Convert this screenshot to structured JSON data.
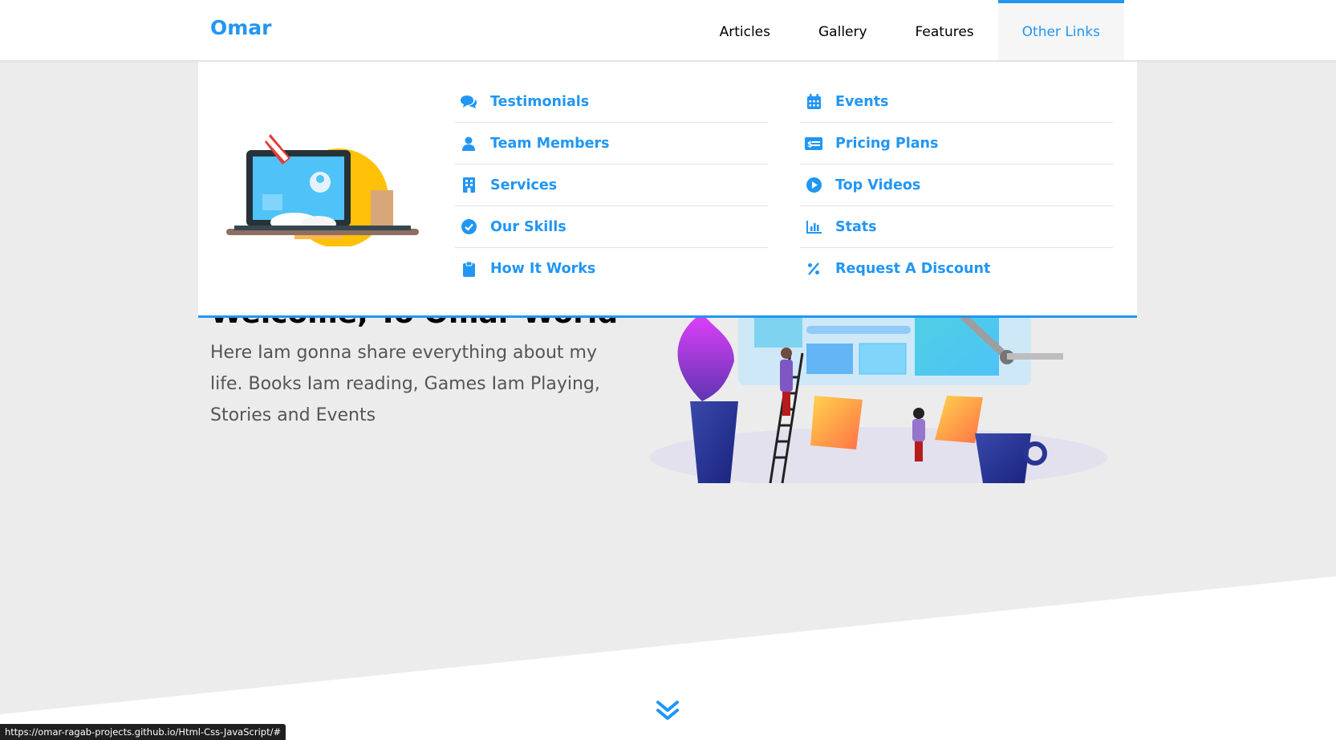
{
  "header": {
    "logo": "Omar",
    "nav": [
      "Articles",
      "Gallery",
      "Features",
      "Other Links"
    ],
    "active_nav": "Other Links"
  },
  "mega_menu": {
    "left_column": [
      {
        "label": "Testimonials",
        "icon": "comments-icon"
      },
      {
        "label": "Team Members",
        "icon": "user-icon"
      },
      {
        "label": "Services",
        "icon": "building-icon"
      },
      {
        "label": "Our Skills",
        "icon": "check-circle-icon"
      },
      {
        "label": "How It Works",
        "icon": "clipboard-icon"
      }
    ],
    "right_column": [
      {
        "label": "Events",
        "icon": "calendar-icon"
      },
      {
        "label": "Pricing Plans",
        "icon": "money-card-icon"
      },
      {
        "label": "Top Videos",
        "icon": "play-circle-icon"
      },
      {
        "label": "Stats",
        "icon": "chart-bar-icon"
      },
      {
        "label": "Request A Discount",
        "icon": "percent-icon"
      }
    ]
  },
  "hero": {
    "title": "Welcome, To Omar World",
    "text": "Here Iam gonna share everything about my life. Books Iam reading, Games Iam Playing, Stories and Events"
  },
  "status_bar": {
    "url": "https://omar-ragab-projects.github.io/Html-Css-JavaScript/#"
  },
  "colors": {
    "accent": "#2196f3",
    "background": "#ececec"
  }
}
